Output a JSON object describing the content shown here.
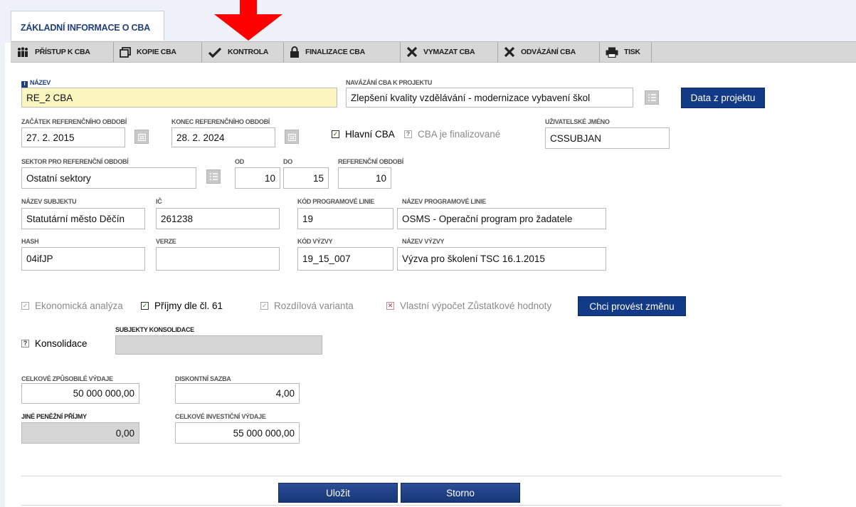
{
  "tab": {
    "label": "ZÁKLADNÍ INFORMACE O CBA"
  },
  "toolbar": {
    "access": "PŘÍSTUP K CBA",
    "copy": "KOPIE CBA",
    "check": "KONTROLA",
    "finalize": "FINALIZACE CBA",
    "delete": "VYMAZAT CBA",
    "unlink": "ODVÁZÁNÍ CBA",
    "print": "TISK"
  },
  "form": {
    "name_label": "NÁZEV",
    "name_value": "RE_2 CBA",
    "link_label": "NAVÁZÁNÍ CBA K PROJEKTU",
    "link_value": "Zlepšení kvality vzdělávání - modernizace vybavení škol",
    "data_button": "Data z projektu",
    "start_label": "ZAČÁTEK REFERENČNÍHO OBDOBÍ",
    "start_value": "27. 2. 2015",
    "end_label": "KONEC REFERENČNÍHO OBDOBÍ",
    "end_value": "28. 2. 2024",
    "main_cba": "Hlavní CBA",
    "finalized": "CBA je finalizované",
    "user_label": "UŽIVATELSKÉ JMÉNO",
    "user_value": "CSSUBJAN",
    "sector_label": "SEKTOR PRO REFERENČNÍ OBDOBÍ",
    "sector_value": "Ostatní sektory",
    "from_label": "OD",
    "from_value": "10",
    "to_label": "DO",
    "to_value": "15",
    "ref_label": "REFERENČNÍ OBDOBÍ",
    "ref_value": "10",
    "subject_label": "NÁZEV SUBJEKTU",
    "subject_value": "Statutární město Děčín",
    "ic_label": "IČ",
    "ic_value": "261238",
    "progcode_label": "KÓD PROGRAMOVÉ LINIE",
    "progcode_value": "19",
    "progname_label": "NÁZEV PROGRAMOVÉ LINIE",
    "progname_value": "OSMS - Operační program pro žadatele",
    "hash_label": "HASH",
    "hash_value": "04ifJP",
    "version_label": "VERZE",
    "version_value": "",
    "callcode_label": "KÓD VÝZVY",
    "callcode_value": "19_15_007",
    "callname_label": "NÁZEV VÝZVY",
    "callname_value": "Výzva pro školení TSC 16.1.2015",
    "econ": "Ekonomická analýza",
    "income": "Příjmy dle čl. 61",
    "diff": "Rozdílová varianta",
    "own_calc": "Vlastní výpočet Zůstatkové hodnoty",
    "change_button": "Chci provést změnu",
    "consolidation": "Konsolidace",
    "consol_subjects_label": "SUBJEKTY KONSOLIDACE",
    "consol_subjects_value": "",
    "total_elig_label": "CELKOVÉ ZPŮSOBILÉ VÝDAJE",
    "total_elig_value": "50 000 000,00",
    "discount_label": "DISKONTNÍ SAZBA",
    "discount_value": "4,00",
    "other_income_label": "JINÉ PENĚŽNÍ PŘÍJMY",
    "other_income_value": "0,00",
    "total_invest_label": "CELKOVÉ INVESTIČNÍ VÝDAJE",
    "total_invest_value": "55 000 000,00"
  },
  "footer": {
    "save": "Uložit",
    "cancel": "Storno"
  },
  "colors": {
    "accent": "#123a86",
    "toolbar": "#d7d7d7",
    "required_field": "#fbf6bf",
    "arrow": "#ff0000"
  }
}
